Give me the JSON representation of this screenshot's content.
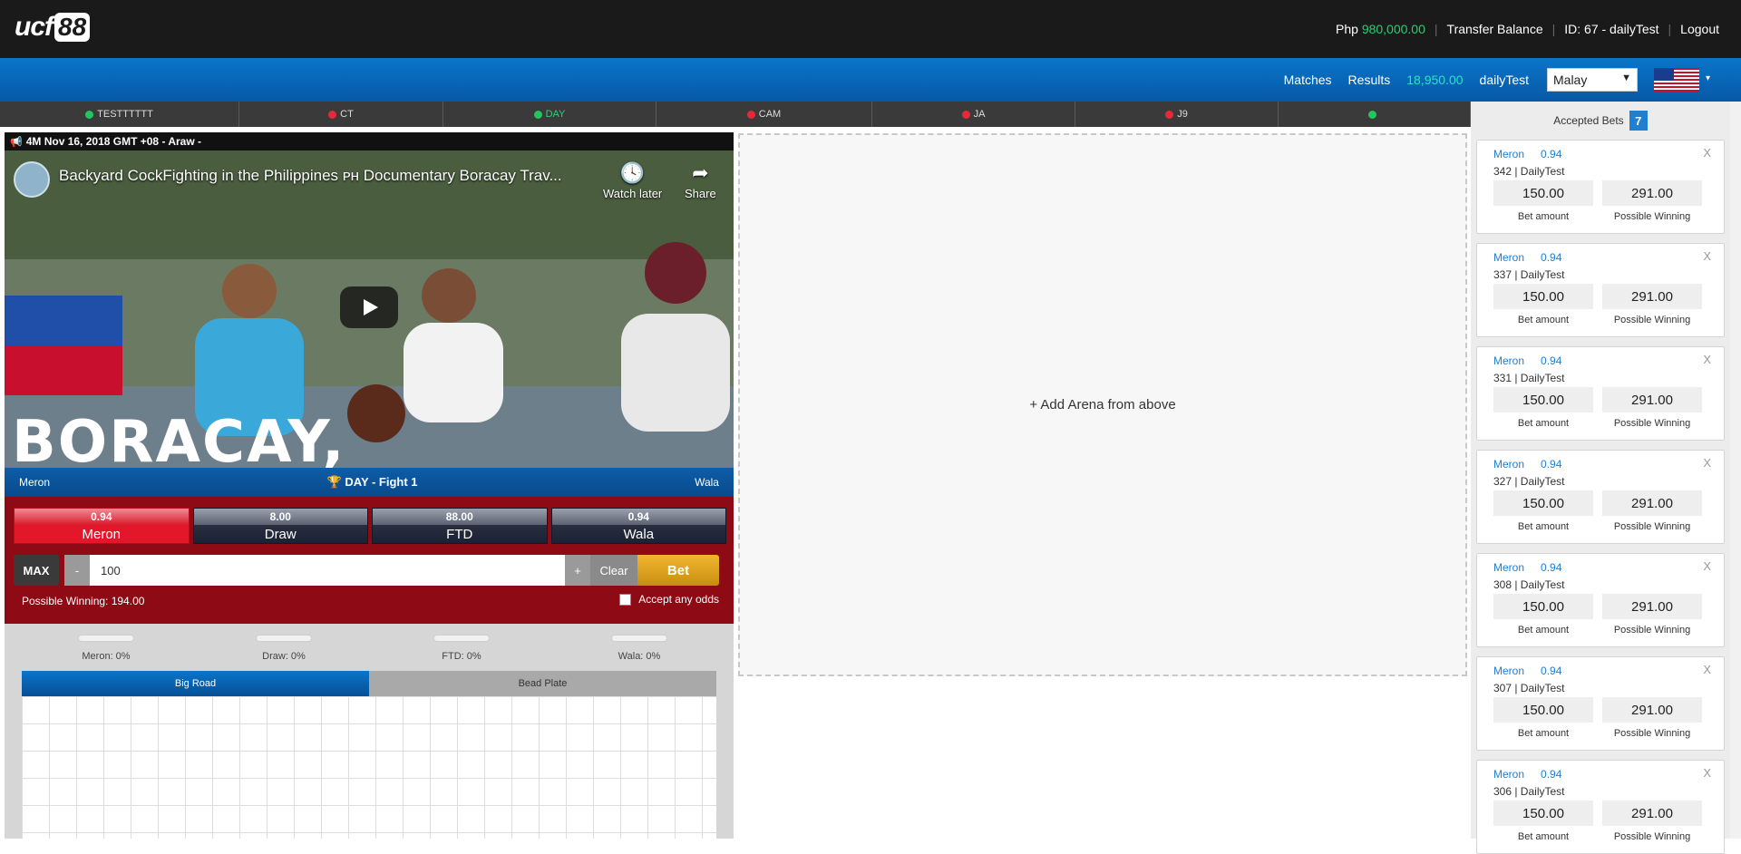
{
  "logo": {
    "text": "ucf",
    "num": "88"
  },
  "topbar": {
    "currency_label": "Php",
    "balance": "980,000.00",
    "transfer": "Transfer Balance",
    "id_text": "ID: 67 - dailyTest",
    "logout": "Logout"
  },
  "nav": {
    "matches": "Matches",
    "results": "Results",
    "credit": "18,950.00",
    "user": "dailyTest",
    "language": "Malay",
    "caret": "▼",
    "flag_caret": "▾"
  },
  "arenas": [
    {
      "label": "TESTTTTTT",
      "status": "green"
    },
    {
      "label": "CT",
      "status": "red"
    },
    {
      "label": "DAY",
      "status": "green",
      "active": true
    },
    {
      "label": "CAM",
      "status": "red"
    },
    {
      "label": "JA",
      "status": "red"
    },
    {
      "label": "J9",
      "status": "red"
    },
    {
      "label": "",
      "status": "green"
    }
  ],
  "video": {
    "header": "4M Nov 16, 2018 GMT +08 - Araw -",
    "title": "Backyard CockFighting in the Philippines ᴘʜ Documentary Boracay Trav...",
    "watch_later": "Watch later",
    "share": "Share",
    "overlay_text": "BORACAY,",
    "watch_icon": "clock-icon",
    "share_icon": "share-arrow-icon"
  },
  "fight": {
    "left": "Meron",
    "title": "DAY - Fight 1",
    "right": "Wala",
    "trophy": "🏆"
  },
  "odds": [
    {
      "value": "0.94",
      "name": "Meron",
      "selected": true
    },
    {
      "value": "8.00",
      "name": "Draw"
    },
    {
      "value": "88.00",
      "name": "FTD"
    },
    {
      "value": "0.94",
      "name": "Wala"
    }
  ],
  "bet": {
    "max": "MAX",
    "minus": "-",
    "amount": "100",
    "plus": "+",
    "clear": "Clear",
    "bet": "Bet",
    "possible_winning": "Possible Winning: 194.00",
    "accept_any_odds": "Accept any odds"
  },
  "stats": [
    {
      "label": "Meron: 0%"
    },
    {
      "label": "Draw: 0%"
    },
    {
      "label": "FTD: 0%"
    },
    {
      "label": "Wala: 0%"
    }
  ],
  "road": {
    "big_road": "Big Road",
    "bead_plate": "Bead Plate"
  },
  "add_arena": "+ Add Arena from above",
  "accepted": {
    "title": "Accepted Bets",
    "count": "7",
    "bets": [
      {
        "side": "Meron",
        "odds": "0.94",
        "ref": "342 | DailyTest",
        "amount": "150.00",
        "winning": "291.00",
        "amount_label": "Bet amount",
        "winning_label": "Possible Winning",
        "close": "X"
      },
      {
        "side": "Meron",
        "odds": "0.94",
        "ref": "337 | DailyTest",
        "amount": "150.00",
        "winning": "291.00",
        "amount_label": "Bet amount",
        "winning_label": "Possible Winning",
        "close": "X"
      },
      {
        "side": "Meron",
        "odds": "0.94",
        "ref": "331 | DailyTest",
        "amount": "150.00",
        "winning": "291.00",
        "amount_label": "Bet amount",
        "winning_label": "Possible Winning",
        "close": "X"
      },
      {
        "side": "Meron",
        "odds": "0.94",
        "ref": "327 | DailyTest",
        "amount": "150.00",
        "winning": "291.00",
        "amount_label": "Bet amount",
        "winning_label": "Possible Winning",
        "close": "X"
      },
      {
        "side": "Meron",
        "odds": "0.94",
        "ref": "308 | DailyTest",
        "amount": "150.00",
        "winning": "291.00",
        "amount_label": "Bet amount",
        "winning_label": "Possible Winning",
        "close": "X"
      },
      {
        "side": "Meron",
        "odds": "0.94",
        "ref": "307 | DailyTest",
        "amount": "150.00",
        "winning": "291.00",
        "amount_label": "Bet amount",
        "winning_label": "Possible Winning",
        "close": "X"
      },
      {
        "side": "Meron",
        "odds": "0.94",
        "ref": "306 | DailyTest",
        "amount": "150.00",
        "winning": "291.00",
        "amount_label": "Bet amount",
        "winning_label": "Possible Winning",
        "close": "X"
      }
    ]
  },
  "colors": {
    "accent_blue": "#0a75c9",
    "bet_red": "#8e0a14",
    "selected_red": "#e3172a",
    "bet_gold": "#f2b730",
    "balance_green": "#2ecc71",
    "credit_cyan": "#2fe0c9"
  }
}
